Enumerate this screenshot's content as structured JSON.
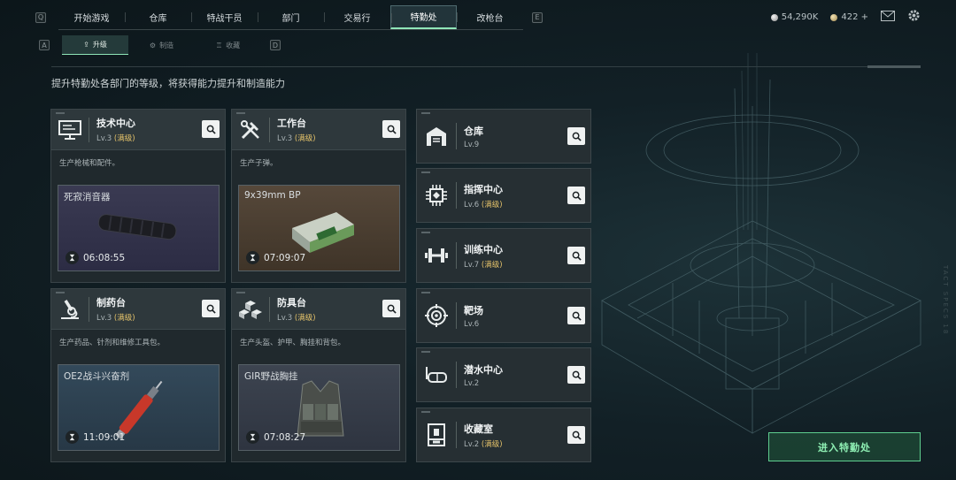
{
  "topnav": {
    "left_key": "Q",
    "right_key": "E",
    "tabs": [
      "开始游戏",
      "仓库",
      "特战干员",
      "部门",
      "交易行",
      "特勤处",
      "改枪台"
    ],
    "active_index": 5
  },
  "currency": {
    "silver": "54,290K",
    "gold": "422 +"
  },
  "subnav": {
    "left_key": "A",
    "right_key": "D",
    "tabs": [
      "升级",
      "制造",
      "收藏"
    ],
    "active_index": 0
  },
  "intro": "提升特勤处各部门的等级，将获得能力提升和制造能力",
  "cards": [
    {
      "name": "技术中心",
      "level": "Lv.3",
      "max": "(满级)",
      "desc": "生产枪械和配件。",
      "product": "死寂消音器",
      "timer": "06:08:55",
      "icon": "computer-icon"
    },
    {
      "name": "工作台",
      "level": "Lv.3",
      "max": "(满级)",
      "desc": "生产子弹。",
      "product": "9x39mm BP",
      "timer": "07:09:07",
      "icon": "tools-icon"
    },
    {
      "name": "制药台",
      "level": "Lv.3",
      "max": "(满级)",
      "desc": "生产药品、针剂和维修工具包。",
      "product": "OE2战斗兴奋剂",
      "timer": "11:09:01",
      "icon": "microscope-icon"
    },
    {
      "name": "防具台",
      "level": "Lv.3",
      "max": "(满级)",
      "desc": "生产头盔、护甲、胸挂和背包。",
      "product": "GIR野战胸挂",
      "timer": "07:08:27",
      "icon": "armor-icon"
    }
  ],
  "facilities": [
    {
      "name": "仓库",
      "level": "Lv.9",
      "max": "",
      "icon": "warehouse-icon"
    },
    {
      "name": "指挥中心",
      "level": "Lv.6",
      "max": "(满级)",
      "icon": "chip-icon"
    },
    {
      "name": "训练中心",
      "level": "Lv.7",
      "max": "(满级)",
      "icon": "dumbbell-icon"
    },
    {
      "name": "靶场",
      "level": "Lv.6",
      "max": "",
      "icon": "target-icon"
    },
    {
      "name": "潜水中心",
      "level": "Lv.2",
      "max": "",
      "icon": "goggles-icon"
    },
    {
      "name": "收藏室",
      "level": "Lv.2",
      "max": "(满级)",
      "icon": "trophy-case-icon"
    }
  ],
  "enter_button": "进入特勤处"
}
